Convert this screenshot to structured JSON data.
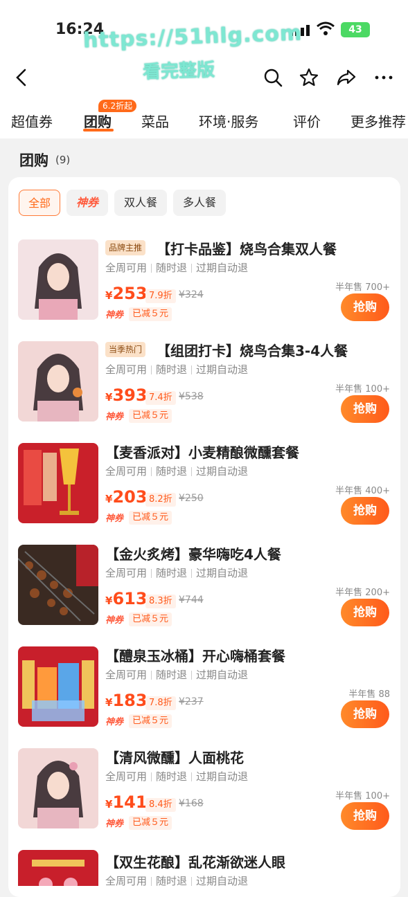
{
  "status": {
    "time": "16:24",
    "battery": "43"
  },
  "watermark": {
    "line1": "https://51hlg.com",
    "line2": "看完整版"
  },
  "nav": {
    "back": "back-icon",
    "search": "search-icon",
    "favorite": "star-icon",
    "share": "share-icon",
    "more": "more-icon"
  },
  "tabs": {
    "items": [
      "超值券",
      "团购",
      "菜品",
      "环境·服务",
      "评价",
      "更多推荐"
    ],
    "active": "团购",
    "badge": "6.2折起"
  },
  "section": {
    "title": "团购",
    "count": "(9)"
  },
  "filters": [
    "全部",
    "神券",
    "双人餐",
    "多人餐"
  ],
  "labels": {
    "buy": "抢购",
    "brand_coupon": "神券"
  },
  "deals": [
    {
      "tag": "品牌主推",
      "title": "【打卡品鉴】烧鸟合集双人餐",
      "meta": [
        "全周可用",
        "随时退",
        "过期自动退"
      ],
      "currency": "¥",
      "price": "253",
      "discount": "7.9折",
      "original": "¥324",
      "saved": "已减５元",
      "sold": "半年售 700+"
    },
    {
      "tag": "当季热门",
      "title": "【组团打卡】烧鸟合集3-4人餐",
      "meta": [
        "全周可用",
        "随时退",
        "过期自动退"
      ],
      "currency": "¥",
      "price": "393",
      "discount": "7.4折",
      "original": "¥538",
      "saved": "已减５元",
      "sold": "半年售 100+"
    },
    {
      "tag": "",
      "title": "【麦香派对】小麦精酿微醺套餐",
      "meta": [
        "全周可用",
        "随时退",
        "过期自动退"
      ],
      "currency": "¥",
      "price": "203",
      "discount": "8.2折",
      "original": "¥250",
      "saved": "已减５元",
      "sold": "半年售 400+"
    },
    {
      "tag": "",
      "title": "【金火炙烤】豪华嗨吃4人餐",
      "meta": [
        "全周可用",
        "随时退",
        "过期自动退"
      ],
      "currency": "¥",
      "price": "613",
      "discount": "8.3折",
      "original": "¥744",
      "saved": "已减５元",
      "sold": "半年售 200+"
    },
    {
      "tag": "",
      "title": "【醴泉玉冰桶】开心嗨桶套餐",
      "meta": [
        "全周可用",
        "随时退",
        "过期自动退"
      ],
      "currency": "¥",
      "price": "183",
      "discount": "7.8折",
      "original": "¥237",
      "saved": "已减５元",
      "sold": "半年售 88"
    },
    {
      "tag": "",
      "title": "【清风微醺】人面桃花",
      "meta": [
        "全周可用",
        "随时退",
        "过期自动退"
      ],
      "currency": "¥",
      "price": "141",
      "discount": "8.4折",
      "original": "¥168",
      "saved": "已减５元",
      "sold": "半年售 100+"
    },
    {
      "tag": "",
      "title": "【双生花酿】乱花渐欲迷人眼",
      "meta": [
        "全周可用",
        "随时退",
        "过期自动退"
      ],
      "currency": "",
      "price": "",
      "discount": "",
      "original": "",
      "saved": "",
      "sold": ""
    }
  ]
}
